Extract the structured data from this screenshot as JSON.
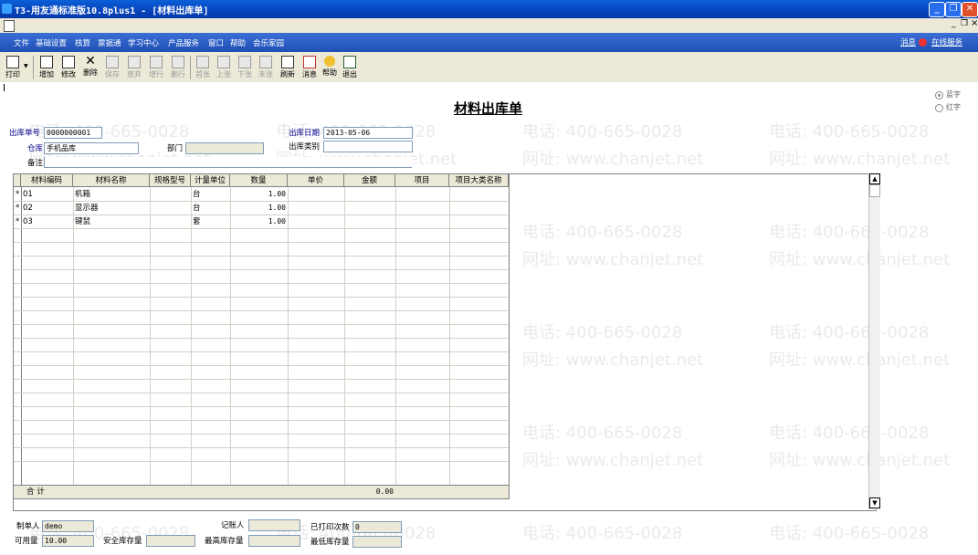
{
  "window": {
    "title": "T3-用友通标准版10.8plus1 - [材料出库单]",
    "min_glyph": "_",
    "max_glyph": "❐",
    "close_glyph": "✕",
    "mdi_min": "_",
    "mdi_restore": "❐",
    "mdi_close": "×"
  },
  "menu": {
    "items": [
      "文件",
      "基础设置",
      "核算",
      "票据通",
      "学习中心",
      "产品服务",
      "窗口",
      "帮助",
      "会乐家园"
    ],
    "right_message": "消息",
    "right_online": "在线服务"
  },
  "toolbar": {
    "buttons": [
      {
        "label": "打印",
        "disabled": false,
        "icon": "printer-icon"
      },
      {
        "label": "增加",
        "disabled": false,
        "icon": "add-icon"
      },
      {
        "label": "修改",
        "disabled": false,
        "icon": "edit-icon"
      },
      {
        "label": "删除",
        "disabled": false,
        "icon": "delete-icon"
      },
      {
        "label": "保存",
        "disabled": true,
        "icon": "save-icon"
      },
      {
        "label": "放弃",
        "disabled": true,
        "icon": "discard-icon"
      },
      {
        "label": "增行",
        "disabled": true,
        "icon": "add-row-icon"
      },
      {
        "label": "删行",
        "disabled": true,
        "icon": "delete-row-icon"
      },
      {
        "label": "首张",
        "disabled": true,
        "icon": "first-icon"
      },
      {
        "label": "上张",
        "disabled": true,
        "icon": "prev-icon"
      },
      {
        "label": "下张",
        "disabled": true,
        "icon": "next-icon"
      },
      {
        "label": "末张",
        "disabled": true,
        "icon": "last-icon"
      },
      {
        "label": "刷新",
        "disabled": false,
        "icon": "refresh-icon"
      },
      {
        "label": "消息",
        "disabled": false,
        "icon": "message-icon"
      },
      {
        "label": "帮助",
        "disabled": false,
        "icon": "help-icon"
      },
      {
        "label": "退出",
        "disabled": false,
        "icon": "exit-icon"
      }
    ]
  },
  "form": {
    "doc_title": "材料出库单",
    "radio_blue": "蓝字",
    "radio_red": "红字",
    "doc_no_label": "出库单号",
    "doc_no_value": "0000000001",
    "date_label": "出库日期",
    "date_value": "2013-05-06",
    "warehouse_label": "仓库",
    "warehouse_value": "手机品库",
    "dept_label": "部门",
    "dept_value": "",
    "outtype_label": "出库类别",
    "outtype_value": "",
    "remark_label": "备注",
    "remark_value": ""
  },
  "grid": {
    "columns": [
      "材料编码",
      "材料名称",
      "规格型号",
      "计量单位",
      "数量",
      "单价",
      "金额",
      "项目",
      "项目大类名称"
    ],
    "rows": [
      {
        "marker": "*",
        "code": "01",
        "name": "机箱",
        "spec": "",
        "unit": "台",
        "qty": "1.00",
        "price": "",
        "amount": "",
        "project": "",
        "category": ""
      },
      {
        "marker": "*",
        "code": "02",
        "name": "显示器",
        "spec": "",
        "unit": "台",
        "qty": "1.00",
        "price": "",
        "amount": "",
        "project": "",
        "category": ""
      },
      {
        "marker": "*",
        "code": "03",
        "name": "键鼠",
        "spec": "",
        "unit": "套",
        "qty": "1.00",
        "price": "",
        "amount": "",
        "project": "",
        "category": ""
      }
    ],
    "sum_label": "合  计",
    "sum_amount": "0.00",
    "scroll_up": "▲",
    "scroll_down": "▼"
  },
  "footer": {
    "maker_label": "制单人",
    "maker_value": "demo",
    "bookkeeper_label": "记账人",
    "bookkeeper_value": "",
    "printed_label": "已打印次数",
    "printed_value": "0",
    "available_label": "可用量",
    "available_value": "10.00",
    "safety_label": "安全库存量",
    "safety_value": "",
    "max_label": "最高库存量",
    "max_value": "",
    "min_label": "最低库存量",
    "min_value": ""
  },
  "watermark": {
    "phone": "电话: 400-665-0028",
    "site": "网址: www.chanjet.net"
  },
  "colors": {
    "title_bar": "#0848c0",
    "menu_bar": "#2a5cc4",
    "label_blue": "#00008b",
    "face": "#ece9d8"
  }
}
